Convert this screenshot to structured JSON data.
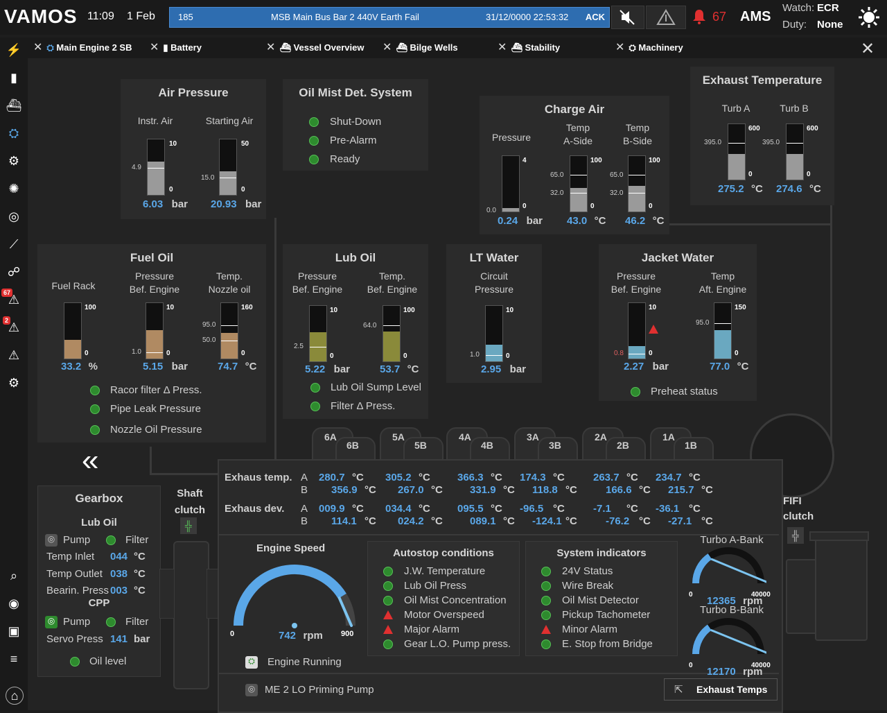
{
  "topbar": {
    "logo": "VAMOS",
    "time": "11:09",
    "date": "1 Feb",
    "alarm": {
      "id": "185",
      "text": "MSB Main Bus Bar 2 440V Earth Fail",
      "timestamp": "31/12/0000 22:53:32",
      "ack": "ACK"
    },
    "alarm_count": "67",
    "ams": "AMS",
    "watch_label": "Watch:",
    "watch_value": "ECR",
    "duty_label": "Duty:",
    "duty_value": "None"
  },
  "tabs": [
    {
      "label": "Main Engine 2 SB",
      "icon": "engine-icon"
    },
    {
      "label": "Battery",
      "icon": "battery-icon"
    },
    {
      "label": "Vessel Overview",
      "icon": "ship-icon"
    },
    {
      "label": "Bilge Wells",
      "icon": "ship-icon"
    },
    {
      "label": "Stability",
      "icon": "ship-icon"
    },
    {
      "label": "Machinery",
      "icon": "engine-icon"
    }
  ],
  "sidebar": {
    "badge1": "67",
    "badge2": "2"
  },
  "air_pressure": {
    "title": "Air Pressure",
    "instr": {
      "label": "Instr. Air",
      "max": "10",
      "min": "0",
      "setpoint": "4.9",
      "value": "6.03",
      "unit": "bar",
      "level": 0.603
    },
    "start": {
      "label": "Starting Air",
      "max": "50",
      "min": "0",
      "setpoint": "15.0",
      "value": "20.93",
      "unit": "bar",
      "level": 0.42
    }
  },
  "oil_mist": {
    "title": "Oil Mist Det. System",
    "items": [
      "Shut-Down",
      "Pre-Alarm",
      "Ready"
    ]
  },
  "charge_air": {
    "title": "Charge Air",
    "pressure": {
      "label": "Pressure",
      "max": "4",
      "min": "0",
      "setpoint": "0.0",
      "value": "0.24",
      "unit": "bar",
      "level": 0.06
    },
    "temp_a": {
      "label1": "Temp",
      "label2": "A-Side",
      "max": "100",
      "min": "0",
      "sp_hi": "65.0",
      "sp_lo": "32.0",
      "value": "43.0",
      "unit": "°C",
      "level": 0.43
    },
    "temp_b": {
      "label1": "Temp",
      "label2": "B-Side",
      "max": "100",
      "min": "0",
      "sp_hi": "65.0",
      "sp_lo": "32.0",
      "value": "46.2",
      "unit": "°C",
      "level": 0.462
    }
  },
  "exhaust_temp": {
    "title": "Exhaust Temperature",
    "turb_a": {
      "label": "Turb A",
      "max": "600",
      "min": "0",
      "setpoint": "395.0",
      "value": "275.2",
      "unit": "°C",
      "level": 0.46
    },
    "turb_b": {
      "label": "Turb B",
      "max": "600",
      "min": "0",
      "setpoint": "395.0",
      "value": "274.6",
      "unit": "°C",
      "level": 0.46
    }
  },
  "fuel_oil": {
    "title": "Fuel Oil",
    "rack": {
      "label": "Fuel Rack",
      "max": "100",
      "min": "0",
      "value": "33.2",
      "unit": "%",
      "level": 0.332
    },
    "press": {
      "label1": "Pressure",
      "label2": "Bef. Engine",
      "max": "10",
      "min": "0",
      "setpoint": "1.0",
      "value": "5.15",
      "unit": "bar",
      "level": 0.515
    },
    "temp": {
      "label1": "Temp.",
      "label2": "Nozzle oil",
      "max": "160",
      "min": "0",
      "sp_hi": "95.0",
      "sp_lo": "50.0",
      "value": "74.7",
      "unit": "°C",
      "level": 0.467
    },
    "items": [
      "Racor filter Δ Press.",
      "Pipe Leak Pressure",
      "Nozzle Oil Pressure"
    ]
  },
  "lub_oil": {
    "title": "Lub Oil",
    "press": {
      "label1": "Pressure",
      "label2": "Bef. Engine",
      "max": "10",
      "min": "0",
      "setpoint": "2.5",
      "value": "5.22",
      "unit": "bar",
      "level": 0.522
    },
    "temp": {
      "label1": "Temp.",
      "label2": "Bef. Engine",
      "max": "100",
      "min": "0",
      "setpoint": "64.0",
      "value": "53.7",
      "unit": "°C",
      "level": 0.537
    },
    "items": [
      "Lub Oil Sump Level",
      "Filter Δ Press."
    ]
  },
  "lt_water": {
    "title": "LT Water",
    "circ": {
      "label1": "Circuit",
      "label2": "Pressure",
      "max": "10",
      "min": "0",
      "setpoint": "1.0",
      "value": "2.95",
      "unit": "bar",
      "level": 0.295
    }
  },
  "jacket_water": {
    "title": "Jacket Water",
    "press": {
      "label1": "Pressure",
      "label2": "Bef. Engine",
      "max": "10",
      "min": "0",
      "setpoint": "0.8",
      "value": "2.27",
      "unit": "bar",
      "level": 0.227
    },
    "temp": {
      "label1": "Temp",
      "label2": "Aft. Engine",
      "max": "150",
      "min": "0",
      "setpoint": "95.0",
      "value": "77.0",
      "unit": "°C",
      "level": 0.513
    },
    "item": "Preheat status"
  },
  "cylinders": {
    "top": [
      "6A",
      "5A",
      "4A",
      "3A",
      "2A",
      "1A"
    ],
    "bottom": [
      "6B",
      "5B",
      "4B",
      "3B",
      "2B",
      "1B"
    ]
  },
  "exhaust_table": {
    "temp_label": "Exhaus temp.",
    "dev_label": "Exhaus dev.",
    "row_a": "A",
    "row_b": "B",
    "unit": "°C",
    "temp_a": [
      "280.7",
      "305.2",
      "366.3",
      "174.3",
      "263.7",
      "234.7"
    ],
    "temp_b": [
      "356.9",
      "267.0",
      "331.9",
      "118.8",
      "166.6",
      "215.7"
    ],
    "dev_a": [
      "009.9",
      "034.4",
      "095.5",
      "-96.5",
      "-7.1",
      "-36.1"
    ],
    "dev_b": [
      "114.1",
      "024.2",
      "089.1",
      "-124.1",
      "-76.2",
      "-27.1"
    ]
  },
  "gearbox": {
    "title": "Gearbox",
    "lub_oil": "Lub Oil",
    "pump": "Pump",
    "filter": "Filter",
    "temp_inlet": {
      "label": "Temp Inlet",
      "value": "044",
      "unit": "°C"
    },
    "temp_outlet": {
      "label": "Temp Outlet",
      "value": "038",
      "unit": "°C"
    },
    "bearing": {
      "label": "Bearin. Press",
      "value": "003",
      "unit": "°C"
    },
    "cpp": "CPP",
    "servo": {
      "label": "Servo Press",
      "value": "141",
      "unit": "bar"
    },
    "oil_level": "Oil level"
  },
  "shaft_clutch": {
    "line1": "Shaft",
    "line2": "clutch"
  },
  "fifi_clutch": {
    "line1": "FIFI",
    "line2": "clutch"
  },
  "engine_speed": {
    "title": "Engine Speed",
    "value": "742",
    "unit": "rpm",
    "min": "0",
    "max": "900",
    "level": 0.824
  },
  "engine_running": "Engine Running",
  "priming_pump": "ME 2 LO Priming Pump",
  "autostop": {
    "title": "Autostop conditions",
    "items": [
      {
        "label": "J.W. Temperature",
        "status": "ok"
      },
      {
        "label": "Lub Oil Press",
        "status": "ok"
      },
      {
        "label": "Oil Mist Concentration",
        "status": "ok"
      },
      {
        "label": "Motor Overspeed",
        "status": "alarm"
      },
      {
        "label": "Major Alarm",
        "status": "alarm"
      },
      {
        "label": "Gear L.O. Pump press.",
        "status": "ok"
      }
    ]
  },
  "system_indicators": {
    "title": "System indicators",
    "items": [
      {
        "label": "24V Status",
        "status": "ok"
      },
      {
        "label": "Wire Break",
        "status": "ok"
      },
      {
        "label": "Oil Mist Detector",
        "status": "ok"
      },
      {
        "label": "Pickup Tachometer",
        "status": "ok"
      },
      {
        "label": "Minor Alarm",
        "status": "alarm"
      },
      {
        "label": "E. Stop from Bridge",
        "status": "ok"
      }
    ]
  },
  "turbo_a": {
    "title": "Turbo A-Bank",
    "value": "12365",
    "unit": "rpm",
    "min": "0",
    "max": "40000",
    "level": 0.309
  },
  "turbo_b": {
    "title": "Turbo B-Bank",
    "value": "12170",
    "unit": "rpm",
    "min": "0",
    "max": "40000",
    "level": 0.304
  },
  "exhaust_button": "Exhaust Temps",
  "colors": {
    "accent": "#5aa7e8",
    "ok": "#2e8b2e",
    "alarm": "#e03030",
    "air": "#9a9a9a",
    "fuel": "#b08a62",
    "lub": "#8a8a3a",
    "water": "#6aa8c0"
  }
}
